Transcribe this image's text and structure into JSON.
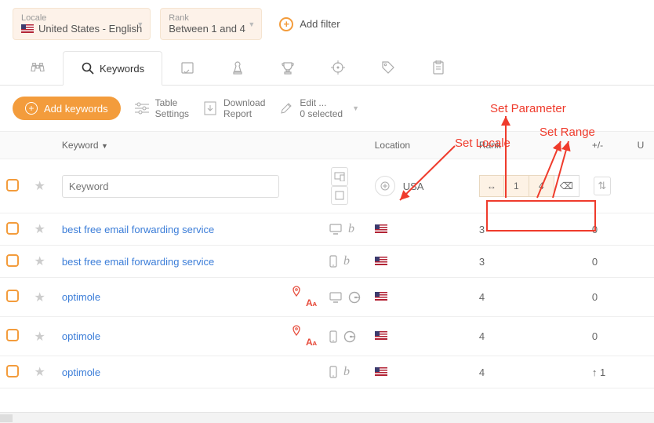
{
  "filters": {
    "locale": {
      "label": "Locale",
      "value": "United States - English"
    },
    "rank": {
      "label": "Rank",
      "value": "Between 1 and 4"
    },
    "add": "Add filter"
  },
  "tabs": {
    "keywords": "Keywords"
  },
  "actions": {
    "add_keywords": "Add keywords",
    "table_settings": {
      "line1": "Table",
      "line2": "Settings"
    },
    "download": {
      "line1": "Download",
      "line2": "Report"
    },
    "edit": {
      "line1": "Edit ...",
      "line2": "0 selected"
    }
  },
  "headers": {
    "keyword": "Keyword",
    "location": "Location",
    "rank": "Rank",
    "delta": "+/-",
    "last": "U"
  },
  "filterRow": {
    "keyword_placeholder": "Keyword",
    "location_value": "USA",
    "range_low": "1",
    "range_high": "4"
  },
  "rows": [
    {
      "keyword": "best free email forwarding service",
      "pin": false,
      "txt": false,
      "device": "desktop",
      "engine": "bing",
      "rank": "3",
      "delta": "0",
      "delta_dir": ""
    },
    {
      "keyword": "best free email forwarding service",
      "pin": false,
      "txt": false,
      "device": "mobile",
      "engine": "bing",
      "rank": "3",
      "delta": "0",
      "delta_dir": ""
    },
    {
      "keyword": "optimole",
      "pin": true,
      "txt": true,
      "device": "desktop",
      "engine": "google",
      "rank": "4",
      "delta": "0",
      "delta_dir": ""
    },
    {
      "keyword": "optimole",
      "pin": true,
      "txt": true,
      "device": "mobile",
      "engine": "google",
      "rank": "4",
      "delta": "0",
      "delta_dir": ""
    },
    {
      "keyword": "optimole",
      "pin": false,
      "txt": false,
      "device": "mobile",
      "engine": "bing",
      "rank": "4",
      "delta": "1",
      "delta_dir": "up"
    }
  ],
  "annotations": {
    "locale": "Set Locale",
    "parameter": "Set Parameter",
    "range": "Set Range"
  }
}
